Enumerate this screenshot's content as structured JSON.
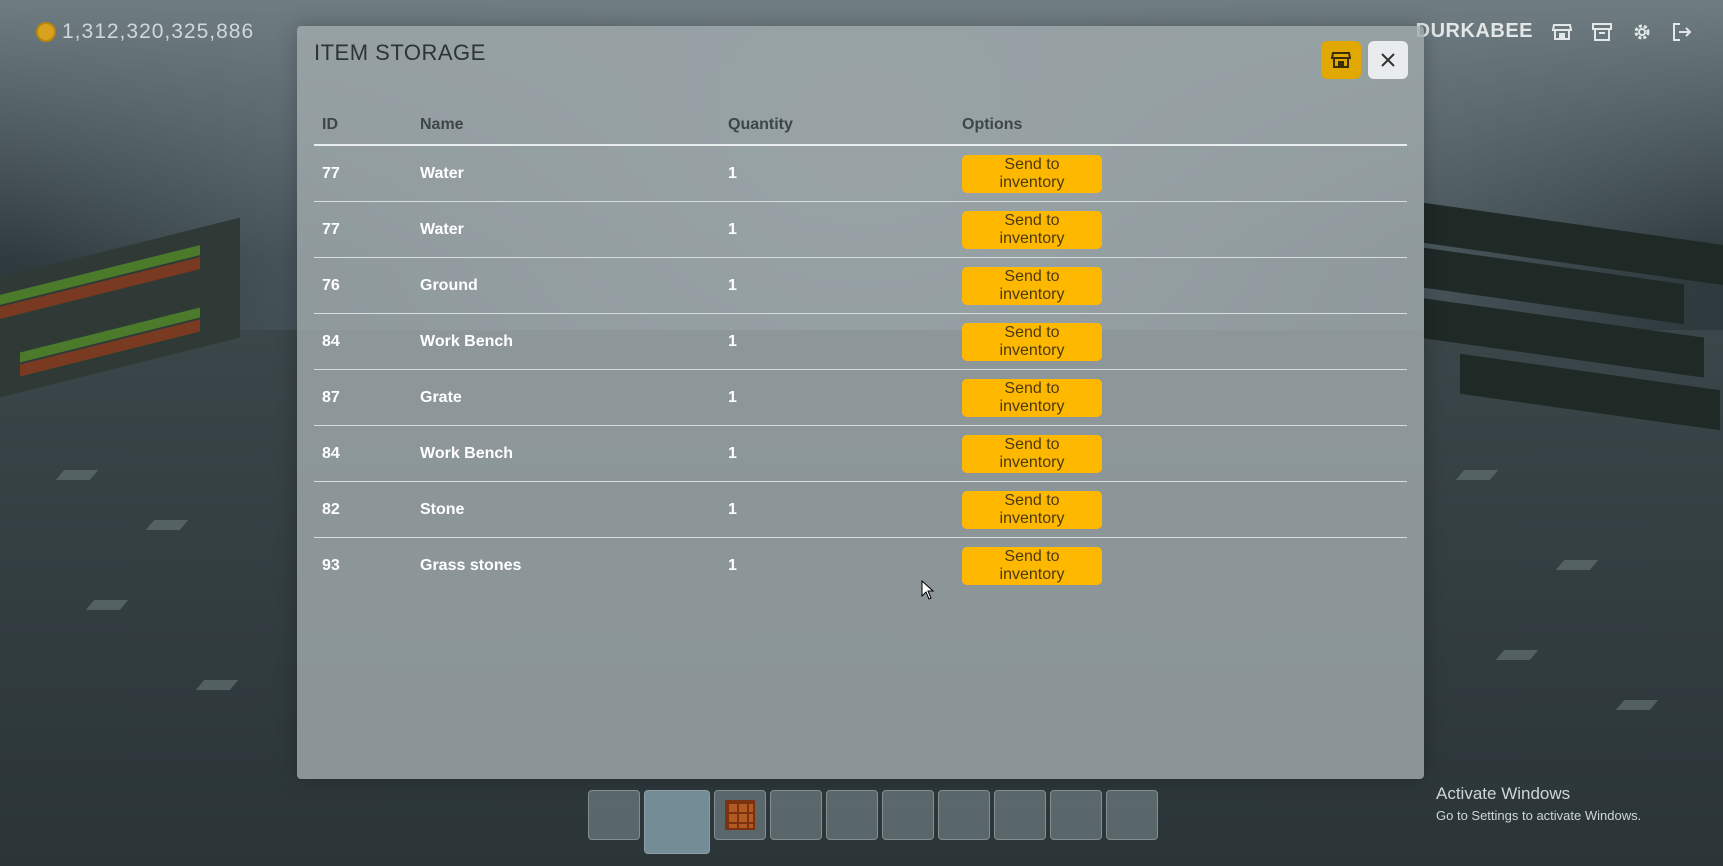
{
  "hud": {
    "coins": "1,312,320,325,886",
    "username": "DURKABEE",
    "icons": [
      "store-icon",
      "archive-icon",
      "gear-icon",
      "logout-icon"
    ]
  },
  "modal": {
    "title": "ITEM STORAGE",
    "store_icon": "store-icon",
    "close_icon": "close-icon"
  },
  "table": {
    "headers": {
      "id": "ID",
      "name": "Name",
      "quantity": "Quantity",
      "options": "Options"
    },
    "rows": [
      {
        "id": "77",
        "name": "Water",
        "quantity": "1",
        "action": "Send to inventory"
      },
      {
        "id": "77",
        "name": "Water",
        "quantity": "1",
        "action": "Send to inventory"
      },
      {
        "id": "76",
        "name": "Ground",
        "quantity": "1",
        "action": "Send to inventory"
      },
      {
        "id": "84",
        "name": "Work Bench",
        "quantity": "1",
        "action": "Send to inventory"
      },
      {
        "id": "87",
        "name": "Grate",
        "quantity": "1",
        "action": "Send to inventory"
      },
      {
        "id": "84",
        "name": "Work Bench",
        "quantity": "1",
        "action": "Send to inventory"
      },
      {
        "id": "82",
        "name": "Stone",
        "quantity": "1",
        "action": "Send to inventory"
      },
      {
        "id": "93",
        "name": "Grass stones",
        "quantity": "1",
        "action": "Send to inventory"
      }
    ]
  },
  "hotbar": {
    "slot_count": 10,
    "selected_slot": 2,
    "item_slot": 3,
    "item_icon": "crafting-table-icon"
  },
  "watermark": {
    "line1": "Activate Windows",
    "line2": "Go to Settings to activate Windows."
  },
  "colors": {
    "accent": "#ffb800",
    "modal_bg": "#a0aaac"
  }
}
